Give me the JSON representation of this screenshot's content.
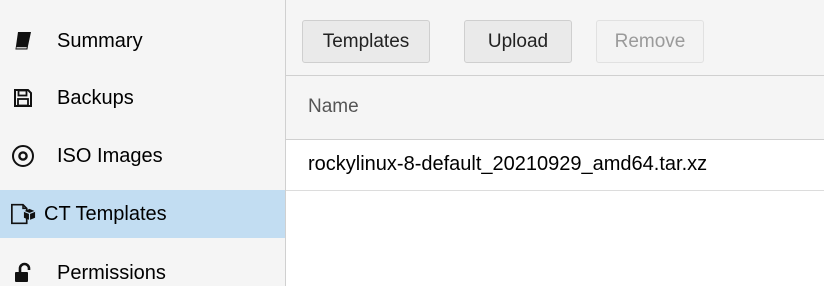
{
  "sidebar": {
    "items": [
      {
        "label": "Summary",
        "icon": "book-icon",
        "selected": false
      },
      {
        "label": "Backups",
        "icon": "floppy-disk-icon",
        "selected": false
      },
      {
        "label": "ISO Images",
        "icon": "disc-icon",
        "selected": false
      },
      {
        "label": "CT Templates",
        "icon": "container-template-icon",
        "selected": true
      },
      {
        "label": "Permissions",
        "icon": "unlock-icon",
        "selected": false
      }
    ]
  },
  "toolbar": {
    "templates_label": "Templates",
    "upload_label": "Upload",
    "remove_label": "Remove"
  },
  "grid": {
    "columns": [
      "Name"
    ],
    "rows": [
      {
        "name": "rockylinux-8-default_20210929_amd64.tar.xz"
      }
    ]
  },
  "colors": {
    "selected_background": "#c2ddf2",
    "panel_background": "#f5f5f5"
  }
}
